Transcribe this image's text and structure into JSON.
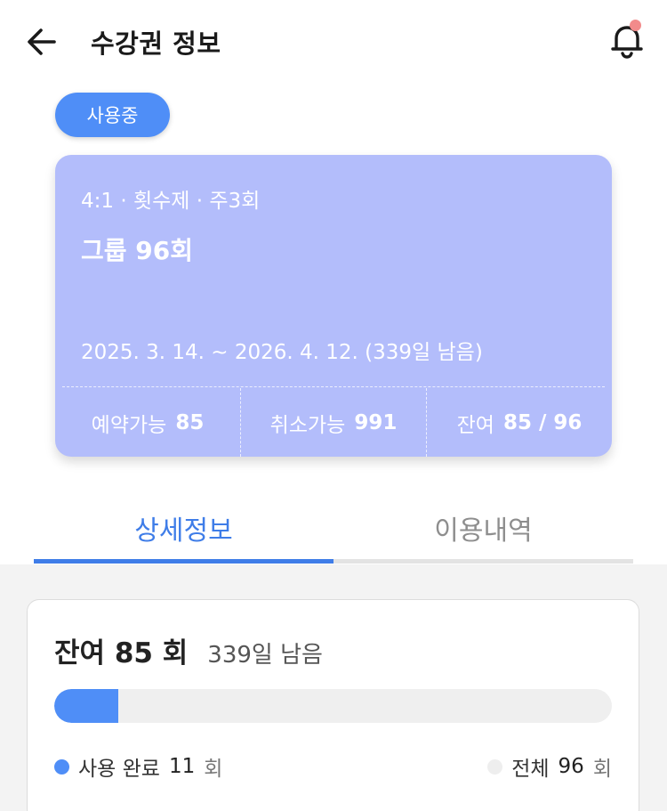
{
  "header": {
    "title": "수강권 정보",
    "back_icon": "arrow-left-icon",
    "bell_icon": "bell-icon",
    "notification_dot_color": "#f28b8b"
  },
  "ticket": {
    "status_badge": "사용중",
    "badge_color": "#4f8ef7",
    "card_color": "#b3bdfb",
    "subtitle": "4:1 · 횟수제 · 주3회",
    "name": "그룹 96회",
    "period": "2025. 3. 14. ~ 2026. 4. 12. (339일 남음)",
    "stats": [
      {
        "label": "예약가능",
        "value": "85"
      },
      {
        "label": "취소가능",
        "value": "991"
      },
      {
        "label": "잔여",
        "value": "85 / 96"
      }
    ]
  },
  "tabs": [
    {
      "label": "상세정보",
      "active": true
    },
    {
      "label": "이용내역",
      "active": false
    }
  ],
  "detail": {
    "remain_label": "잔여 85 회",
    "remain_days": "339일 남음",
    "progress_fraction": 0.115,
    "used_label": "사용 완료",
    "used_value": "11",
    "used_unit": "회",
    "total_label": "전체",
    "total_value": "96",
    "total_unit": "회"
  }
}
